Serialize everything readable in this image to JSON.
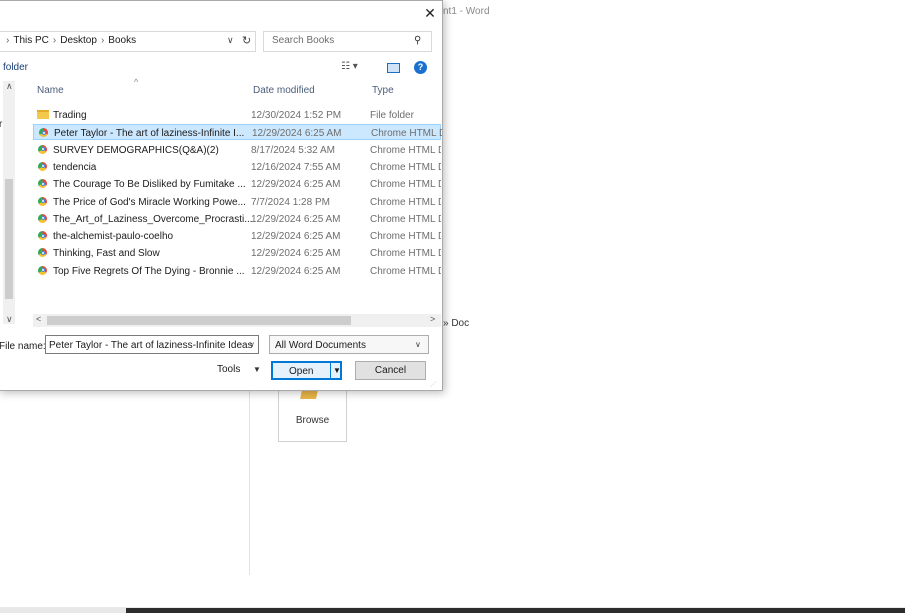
{
  "background": {
    "window_title": "nt1 - Word",
    "path_fragment": "» Doc",
    "browse_label": "Browse"
  },
  "dialog": {
    "address": {
      "crumbs": [
        "This PC",
        "Desktop",
        "Books"
      ]
    },
    "search": {
      "placeholder": "Search Books"
    },
    "toolbar": {
      "new_folder": "folder"
    },
    "nav_partial_text": "r",
    "columns": {
      "name": "Name",
      "date": "Date modified",
      "type": "Type"
    },
    "files": [
      {
        "name": "Trading",
        "date": "12/30/2024 1:52 PM",
        "type": "File folder",
        "kind": "folder",
        "selected": false
      },
      {
        "name": "Peter Taylor - The art of laziness-Infinite I...",
        "date": "12/29/2024 6:25 AM",
        "type": "Chrome HTML D",
        "kind": "html",
        "selected": true
      },
      {
        "name": "SURVEY DEMOGRAPHICS(Q&A)(2)",
        "date": "8/17/2024 5:32 AM",
        "type": "Chrome HTML D",
        "kind": "html",
        "selected": false
      },
      {
        "name": "tendencia",
        "date": "12/16/2024 7:55 AM",
        "type": "Chrome HTML D",
        "kind": "html",
        "selected": false
      },
      {
        "name": "The Courage To Be Disliked by Fumitake ...",
        "date": "12/29/2024 6:25 AM",
        "type": "Chrome HTML D",
        "kind": "html",
        "selected": false
      },
      {
        "name": "The Price of God's Miracle Working Powe...",
        "date": "7/7/2024 1:28 PM",
        "type": "Chrome HTML D",
        "kind": "html",
        "selected": false
      },
      {
        "name": "The_Art_of_Laziness_Overcome_Procrasti...",
        "date": "12/29/2024 6:25 AM",
        "type": "Chrome HTML D",
        "kind": "html",
        "selected": false
      },
      {
        "name": "the-alchemist-paulo-coelho",
        "date": "12/29/2024 6:25 AM",
        "type": "Chrome HTML D",
        "kind": "html",
        "selected": false
      },
      {
        "name": "Thinking, Fast and Slow",
        "date": "12/29/2024 6:25 AM",
        "type": "Chrome HTML D",
        "kind": "html",
        "selected": false
      },
      {
        "name": "Top Five Regrets Of The Dying - Bronnie ...",
        "date": "12/29/2024 6:25 AM",
        "type": "Chrome HTML D",
        "kind": "html",
        "selected": false
      }
    ],
    "file_name_label": "File name:",
    "file_name_value": "Peter Taylor - The art of laziness-Infinite Ideas",
    "file_type": "All Word Documents",
    "tools_label": "Tools",
    "open_label": "Open",
    "cancel_label": "Cancel"
  },
  "colors": {
    "selection": "#cce8ff",
    "accent": "#0078d7",
    "folder": "#f4c84b"
  }
}
